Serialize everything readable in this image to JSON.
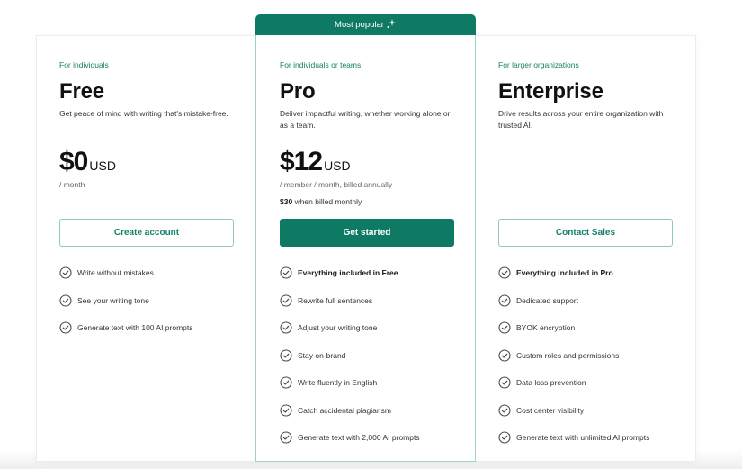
{
  "popular_badge": {
    "label": "Most popular",
    "icon": "sparkle-icon"
  },
  "colors": {
    "brand_green": "#0e7a64",
    "audience_text": "#198066",
    "outline_border": "#8fc9b9",
    "pro_border": "#9fd1c4"
  },
  "plans": [
    {
      "audience": "For individuals",
      "name": "Free",
      "description": "Get peace of mind with writing that's mistake-free.",
      "price_amount": "$0",
      "price_currency": "USD",
      "price_period": "/ month",
      "cta_label": "Create account",
      "features": [
        {
          "label": "Write without mistakes",
          "bold": false
        },
        {
          "label": "See your writing tone",
          "bold": false
        },
        {
          "label": "Generate text with 100 AI prompts",
          "bold": false
        }
      ]
    },
    {
      "audience": "For individuals or teams",
      "name": "Pro",
      "description": "Deliver impactful writing, whether working alone or as a team.",
      "price_amount": "$12",
      "price_currency": "USD",
      "price_period": "/ member / month, billed annually",
      "monthly_price": "$30",
      "monthly_note": "when billed monthly",
      "cta_label": "Get started",
      "features": [
        {
          "label": "Everything included in Free",
          "bold": true
        },
        {
          "label": "Rewrite full sentences",
          "bold": false
        },
        {
          "label": "Adjust your writing tone",
          "bold": false
        },
        {
          "label": "Stay on-brand",
          "bold": false
        },
        {
          "label": "Write fluently in English",
          "bold": false
        },
        {
          "label": "Catch accidental plagiarism",
          "bold": false
        },
        {
          "label": "Generate text with 2,000 AI prompts",
          "bold": false
        }
      ]
    },
    {
      "audience": "For larger organizations",
      "name": "Enterprise",
      "description": "Drive results across your entire organization with trusted AI.",
      "cta_label": "Contact Sales",
      "features": [
        {
          "label": "Everything included in Pro",
          "bold": true
        },
        {
          "label": "Dedicated support",
          "bold": false
        },
        {
          "label": "BYOK encryption",
          "bold": false
        },
        {
          "label": "Custom roles and permissions",
          "bold": false
        },
        {
          "label": "Data loss prevention",
          "bold": false
        },
        {
          "label": "Cost center visibility",
          "bold": false
        },
        {
          "label": "Generate text with unlimited AI prompts",
          "bold": false
        }
      ]
    }
  ]
}
